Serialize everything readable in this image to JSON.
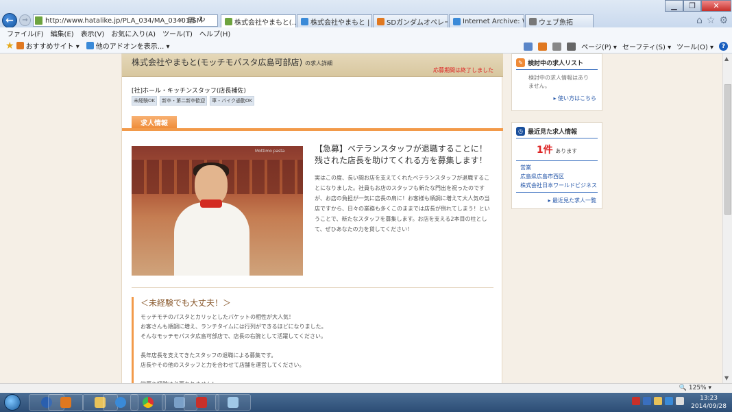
{
  "browser": {
    "url": "http://www.hatalike.jp/PLA_034/MA_03401/SM",
    "tabs": [
      {
        "label": "株式会社やまもと(...",
        "active": true,
        "icon_color": "#6da33e"
      },
      {
        "label": "株式会社やまもと | ...",
        "active": false,
        "icon_color": "#3a8ad8"
      },
      {
        "label": "SDガンダムオペレー...",
        "active": false,
        "icon_color": "#e07820"
      },
      {
        "label": "Internet Archive: W...",
        "active": false,
        "icon_color": "#3a8ad8"
      },
      {
        "label": "ウェブ魚拓",
        "active": false,
        "icon_color": "#777777"
      }
    ],
    "menu": [
      "ファイル(F)",
      "編集(E)",
      "表示(V)",
      "お気に入り(A)",
      "ツール(T)",
      "ヘルプ(H)"
    ],
    "favorites": [
      {
        "label": "おすすめサイト ▾",
        "icon_color": "#e07820"
      },
      {
        "label": "他のアドオンを表示... ▾",
        "icon_color": "#3a8ad8"
      }
    ],
    "commands": [
      "ページ(P) ▾",
      "セーフティ(S) ▾",
      "ツール(O) ▾"
    ],
    "help_glyph": "?",
    "zoom": "🔍 125% ▾"
  },
  "job": {
    "company_title": "株式会社やまもと(モッチモパスタ広島可部店)",
    "company_suffix": "の求人詳細",
    "expired": "応募期間は終了しました",
    "position": "[社]ホール・キッチンスタッフ(店長補佐)",
    "tags": [
      "未経験OK",
      "新卒・第二新卒歓迎",
      "車・バイク通勤OK"
    ],
    "tab_label": "求人情報",
    "photo_sign": "Mottimo pasta",
    "lead_heading": "【急募】ベテランスタッフが退職することに！残された店長を助けてくれる方を募集します！",
    "lead_body": "実はこの度、長い間お店を支えてくれたベテランスタッフが退職することになりました。社員もお店のスタッフも新たな門出を祝ったのですが、お店の負担が一気に店長の肩に！お客様も順調に増えて大人気の当店ですから、日々の業務も多くこのままでは店長が倒れてしまう！ということで、新たなスタッフを募集します。お店を支える2本目の柱として、ぜひあなたの力を貸してください！",
    "section_title": "＜未経験でも大丈夫！＞",
    "section_lines": [
      "モッチモチのパスタとカリッとしたバケットの相性が大人気！",
      "お客さんも順調に増え、ランチタイムには行列ができるほどになりました。",
      "そんなモッチモパスタ広島可部店で、店長の右腕として活躍してください。",
      "",
      "長年店長を支えてきたスタッフの退職による募集です。",
      "店長やその他のスタッフと力を合わせて店舗を運営してください。",
      "",
      "学歴や経験は必要ありません！"
    ]
  },
  "sidebar": {
    "review": {
      "title": "検討中の求人リスト",
      "icon": "pencil-icon",
      "empty_text": "検討中の求人情報はありません。",
      "link": "使い方はこちら"
    },
    "recent": {
      "title": "最近見た求人情報",
      "icon": "clock-icon",
      "count": "1件",
      "count_suffix": "あります",
      "item": [
        "営業",
        "広島県広島市西区",
        "株式会社日本ワールドビジネス"
      ],
      "link": "最近見た求人一覧"
    }
  },
  "taskbar": {
    "time": "13:23",
    "date": "2014/09/28"
  }
}
